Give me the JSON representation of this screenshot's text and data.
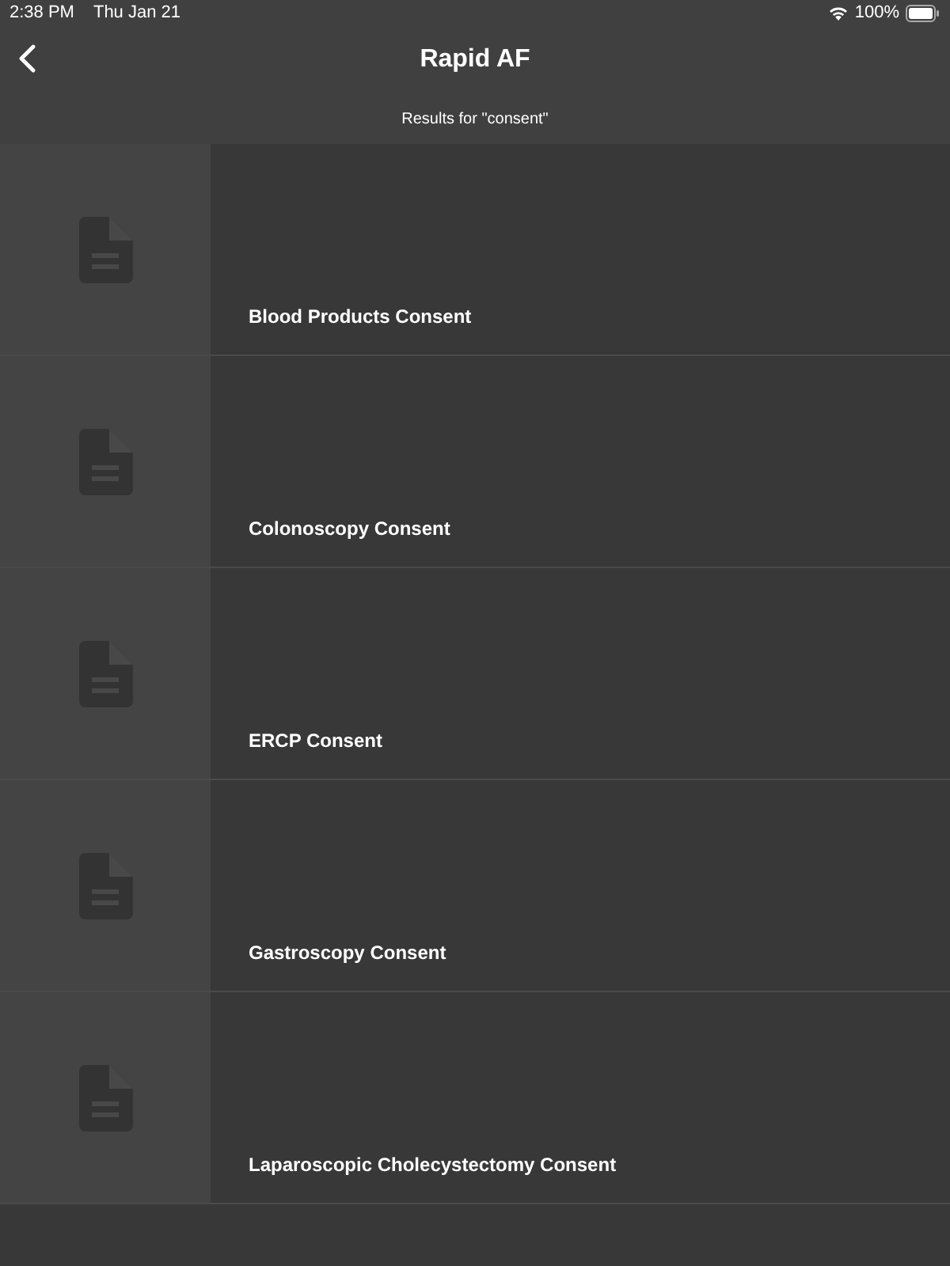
{
  "status_bar": {
    "time": "2:38 PM",
    "date": "Thu Jan 21",
    "battery": "100%"
  },
  "nav": {
    "title": "Rapid AF"
  },
  "subtitle": "Results for \"consent\"",
  "results": [
    {
      "title": "Blood Products Consent"
    },
    {
      "title": "Colonoscopy Consent"
    },
    {
      "title": "ERCP Consent"
    },
    {
      "title": "Gastroscopy Consent"
    },
    {
      "title": "Laparoscopic Cholecystectomy Consent"
    }
  ]
}
